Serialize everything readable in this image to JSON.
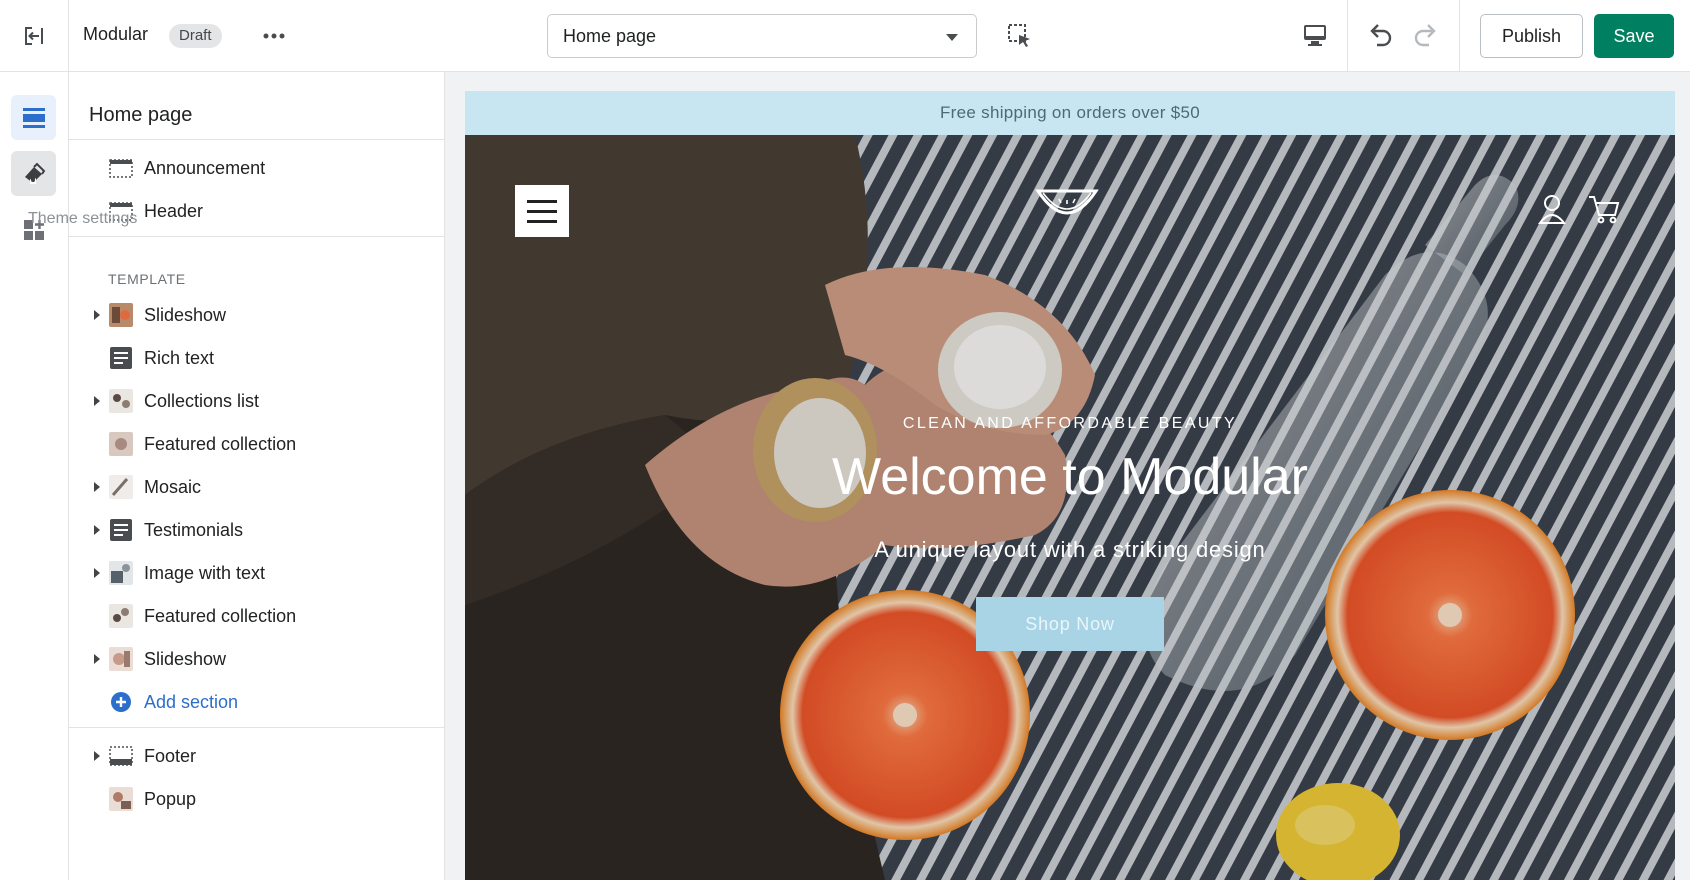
{
  "topbar": {
    "theme_name": "Modular",
    "status_badge": "Draft",
    "page_select": "Home page",
    "publish_label": "Publish",
    "save_label": "Save",
    "save_color": "#008060"
  },
  "rail": {
    "items": [
      "sections",
      "theme-settings",
      "app-embeds"
    ],
    "tooltip": "Theme settings"
  },
  "sidebar": {
    "title": "Home page",
    "header_sections": [
      {
        "label": "Announcement",
        "icon": "section-layout-icon"
      },
      {
        "label": "Header",
        "icon": "section-layout-icon"
      }
    ],
    "template_label": "TEMPLATE",
    "template_sections": [
      {
        "label": "Slideshow",
        "icon": "image-thumb",
        "expandable": true
      },
      {
        "label": "Rich text",
        "icon": "text-block-icon",
        "expandable": false
      },
      {
        "label": "Collections list",
        "icon": "image-thumb",
        "expandable": true
      },
      {
        "label": "Featured collection",
        "icon": "image-thumb",
        "expandable": false
      },
      {
        "label": "Mosaic",
        "icon": "image-thumb",
        "expandable": true
      },
      {
        "label": "Testimonials",
        "icon": "text-block-icon",
        "expandable": true
      },
      {
        "label": "Image with text",
        "icon": "image-thumb",
        "expandable": true
      },
      {
        "label": "Featured collection",
        "icon": "image-thumb",
        "expandable": false
      },
      {
        "label": "Slideshow",
        "icon": "image-thumb",
        "expandable": true
      }
    ],
    "add_section_label": "Add section",
    "footer_sections": [
      {
        "label": "Footer",
        "icon": "section-layout-icon",
        "expandable": true
      },
      {
        "label": "Popup",
        "icon": "image-thumb",
        "expandable": false
      }
    ]
  },
  "preview": {
    "announcement": "Free shipping on orders over $50",
    "announcement_bg": "#c8e6f2",
    "hero_eyebrow": "CLEAN AND AFFORDABLE BEAUTY",
    "hero_title": "Welcome to Modular",
    "hero_subtitle": "A unique layout with a striking design",
    "hero_button": "Shop Now",
    "hero_button_bg": "#a9d4e6"
  }
}
